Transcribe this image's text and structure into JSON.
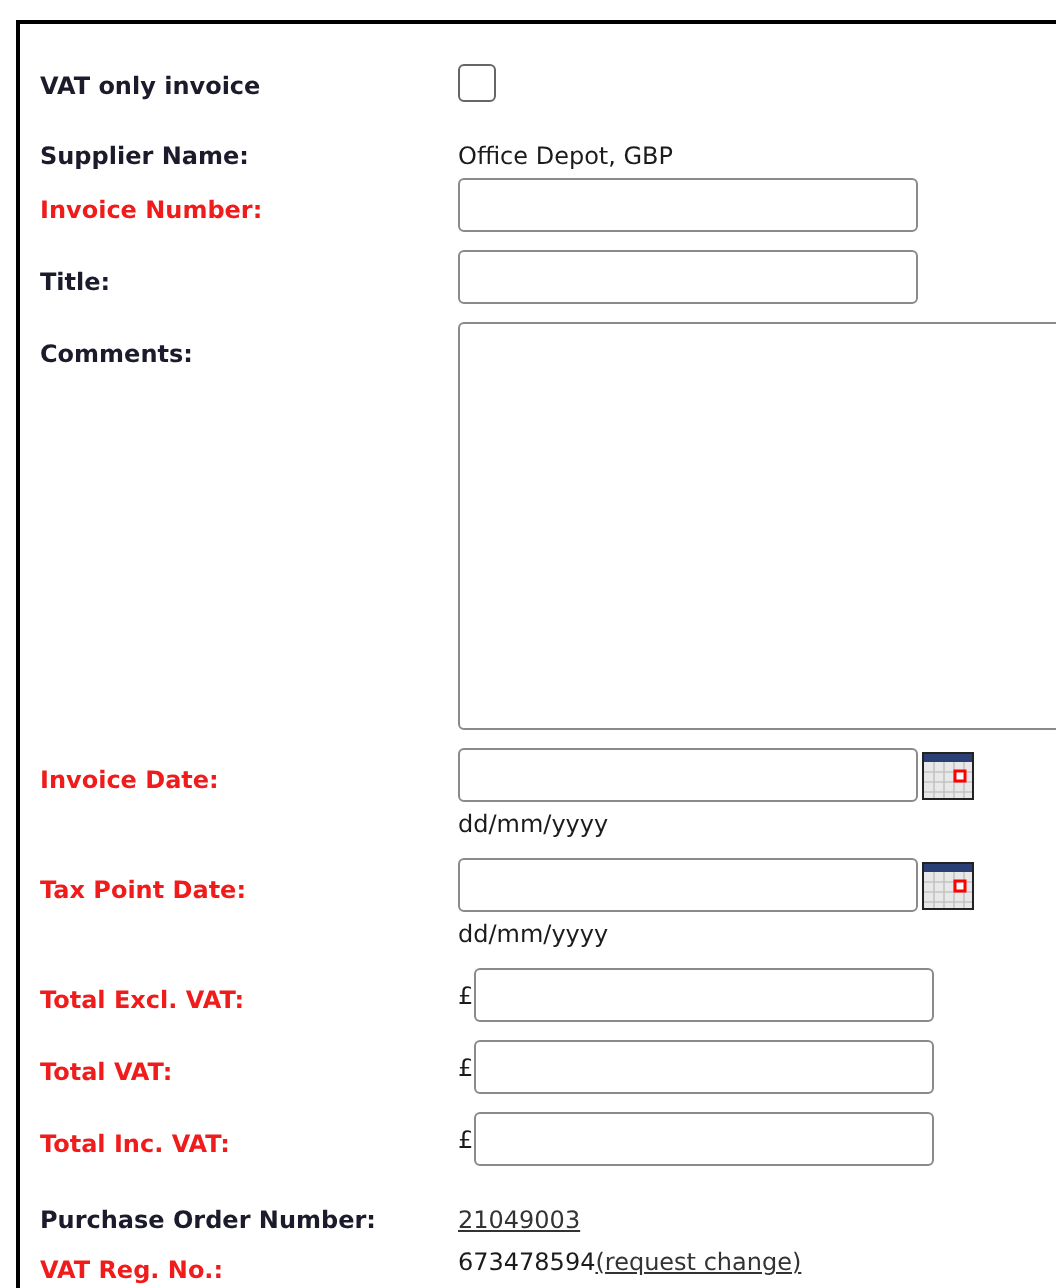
{
  "fields": [
    {
      "kind": "checkbox",
      "label": "VAT only invoice",
      "required": false,
      "checked": false
    },
    {
      "kind": "text",
      "label": "Supplier Name:",
      "required": false,
      "value": "Office Depot, GBP"
    },
    {
      "kind": "input",
      "label": "Invoice Number:",
      "required": true
    },
    {
      "kind": "input",
      "label": "Title:",
      "required": false
    },
    {
      "kind": "textarea",
      "label": "Comments:",
      "required": false
    },
    {
      "kind": "date",
      "label": "Invoice Date:",
      "required": true,
      "hint": "dd/mm/yyyy"
    },
    {
      "kind": "date",
      "label": "Tax Point Date:",
      "required": true,
      "hint": "dd/mm/yyyy"
    },
    {
      "kind": "currency",
      "label": "Total Excl. VAT:",
      "required": true,
      "currency": "£"
    },
    {
      "kind": "currency",
      "label": "Total VAT:",
      "required": true,
      "currency": "£"
    },
    {
      "kind": "currency",
      "label": "Total Inc. VAT:",
      "required": true,
      "currency": "£"
    },
    {
      "kind": "link",
      "label": "Purchase Order Number:",
      "required": false,
      "link": "21049003"
    },
    {
      "kind": "text_link",
      "label": "VAT Reg. No.:",
      "required": true,
      "value": "673478594",
      "link": "(request change)"
    }
  ]
}
